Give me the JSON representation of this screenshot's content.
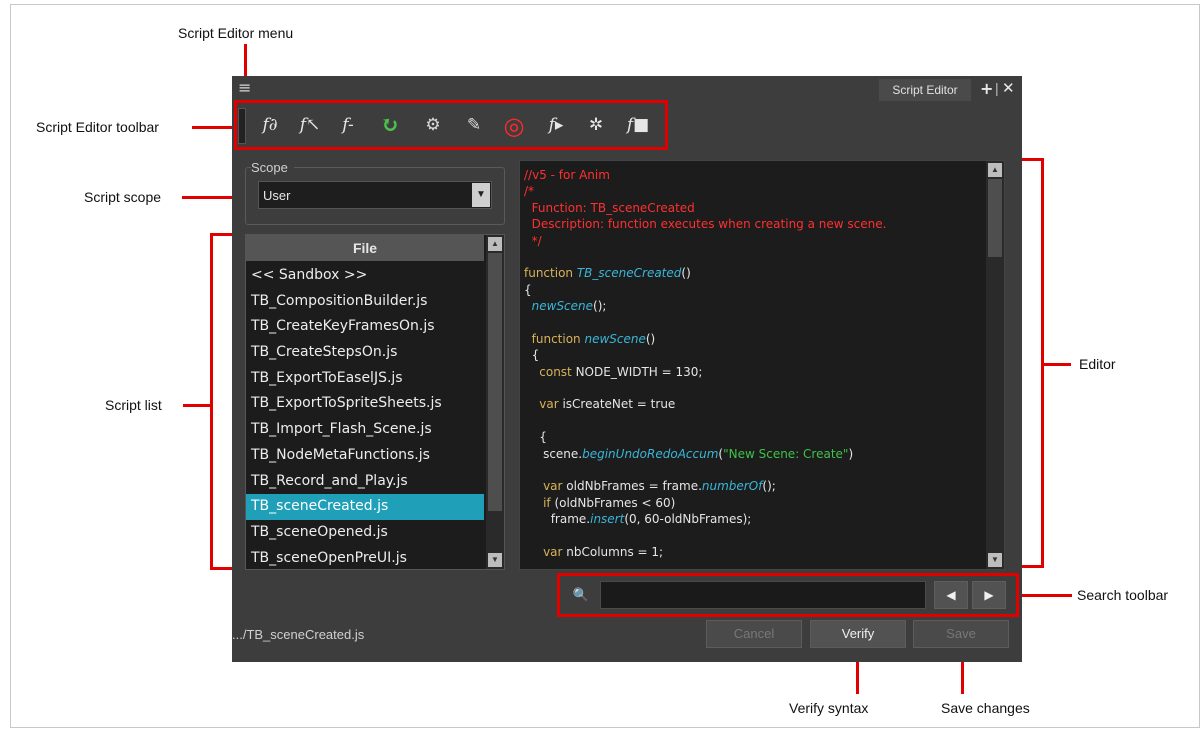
{
  "annotations": {
    "menu": "Script Editor menu",
    "toolbar": "Script Editor toolbar",
    "scope": "Script scope",
    "list": "Script list",
    "editor": "Editor",
    "search": "Search toolbar",
    "verify": "Verify syntax",
    "save": "Save changes"
  },
  "window": {
    "menu_glyph": "≡",
    "tab_title": "Script Editor",
    "tab_add": "+",
    "tab_sep": "|",
    "tab_close": "✕"
  },
  "toolbar": {
    "buttons": [
      {
        "icon": "new-script-icon",
        "glyph": "f∂"
      },
      {
        "icon": "import-script-icon",
        "glyph": "f↖"
      },
      {
        "icon": "delete-script-icon",
        "glyph": "f-"
      },
      {
        "icon": "refresh-icon",
        "glyph": "↻"
      },
      {
        "icon": "set-target-icon",
        "glyph": "⚙"
      },
      {
        "icon": "edit-target-icon",
        "glyph": "✎"
      },
      {
        "icon": "run-target-icon",
        "glyph": "◎"
      },
      {
        "icon": "run-icon",
        "glyph": "f▸"
      },
      {
        "icon": "debug-icon",
        "glyph": "✲"
      },
      {
        "icon": "stop-icon",
        "glyph": "f■"
      }
    ]
  },
  "scope": {
    "label": "Scope",
    "value": "User",
    "arrow": "▼"
  },
  "file_list": {
    "header": "File",
    "items": [
      "<< Sandbox >>",
      "TB_CompositionBuilder.js",
      "TB_CreateKeyFramesOn.js",
      "TB_CreateStepsOn.js",
      "TB_ExportToEaselJS.js",
      "TB_ExportToSpriteSheets.js",
      "TB_Import_Flash_Scene.js",
      "TB_NodeMetaFunctions.js",
      "TB_Record_and_Play.js",
      "TB_sceneCreated.js",
      "TB_sceneOpened.js",
      "TB_sceneOpenPreUI.js"
    ],
    "selected_index": 9
  },
  "code": {
    "lines": [
      [
        [
          "c",
          "//v5 - for Anim"
        ]
      ],
      [
        [
          "c",
          "/*"
        ]
      ],
      [
        [
          "c",
          "  Function: TB_sceneCreated"
        ]
      ],
      [
        [
          "c",
          "  Description: function executes when creating a new scene."
        ]
      ],
      [
        [
          "c",
          "  */"
        ]
      ],
      [],
      [
        [
          "k",
          "function "
        ],
        [
          "f",
          "TB_sceneCreated"
        ],
        [
          "p",
          "()"
        ]
      ],
      [
        [
          "p",
          "{"
        ]
      ],
      [
        [
          "p",
          "  "
        ],
        [
          "f",
          "newScene"
        ],
        [
          "p",
          "();"
        ]
      ],
      [],
      [
        [
          "k",
          "  function "
        ],
        [
          "f",
          "newScene"
        ],
        [
          "p",
          "()"
        ]
      ],
      [
        [
          "p",
          "  {"
        ]
      ],
      [
        [
          "k",
          "    const "
        ],
        [
          "p",
          "NODE_WIDTH = 130;"
        ]
      ],
      [],
      [
        [
          "k",
          "    var "
        ],
        [
          "p",
          "isCreateNet = true"
        ]
      ],
      [],
      [
        [
          "p",
          "    {"
        ]
      ],
      [
        [
          "p",
          "     scene."
        ],
        [
          "f",
          "beginUndoRedoAccum"
        ],
        [
          "p",
          "("
        ],
        [
          "s",
          "\"New Scene: Create\""
        ],
        [
          "p",
          ")"
        ]
      ],
      [],
      [
        [
          "k",
          "     var "
        ],
        [
          "p",
          "oldNbFrames = frame."
        ],
        [
          "f",
          "numberOf"
        ],
        [
          "p",
          "();"
        ]
      ],
      [
        [
          "k",
          "     if "
        ],
        [
          "p",
          "(oldNbFrames < 60)"
        ]
      ],
      [
        [
          "p",
          "       frame."
        ],
        [
          "f",
          "insert"
        ],
        [
          "p",
          "(0, 60-oldNbFrames);"
        ]
      ],
      [],
      [
        [
          "k",
          "     var "
        ],
        [
          "p",
          "nbColumns = 1;"
        ]
      ]
    ]
  },
  "search": {
    "icon": "🔍",
    "value": "",
    "prev": "◀",
    "next": "▶"
  },
  "footer": {
    "path": ".../TB_sceneCreated.js",
    "cancel": "Cancel",
    "verify": "Verify",
    "save": "Save"
  },
  "colors": {
    "accent_red": "#e00000",
    "selection": "#1fa0b8",
    "window_bg": "#3d3d3d"
  }
}
